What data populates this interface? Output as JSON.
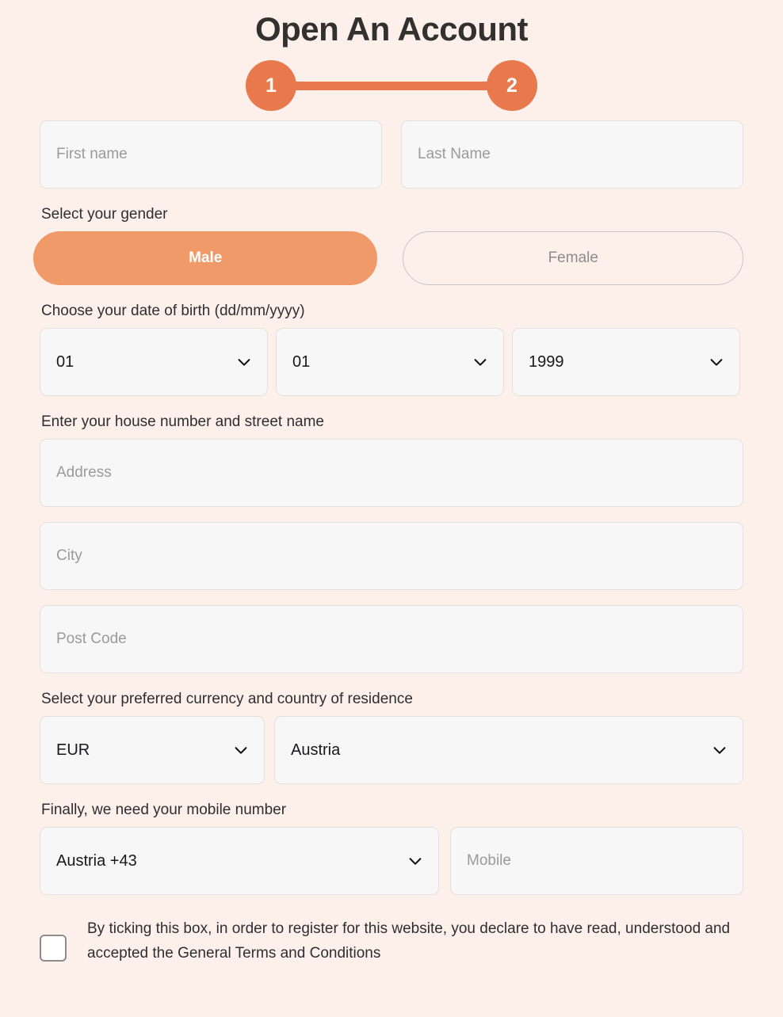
{
  "header": {
    "title": "Open An Account"
  },
  "stepper": {
    "steps": [
      {
        "number": "1",
        "state": "active"
      },
      {
        "number": "2",
        "state": "active"
      }
    ],
    "accent_color": "#e8794c"
  },
  "form": {
    "first_name": {
      "placeholder": "First name",
      "value": ""
    },
    "last_name": {
      "placeholder": "Last Name",
      "value": ""
    },
    "gender": {
      "label": "Select your gender",
      "options": [
        {
          "label": "Male",
          "selected": true
        },
        {
          "label": "Female",
          "selected": false
        }
      ],
      "selected_color": "#f09a69"
    },
    "date_of_birth": {
      "label": "Choose your date of birth (dd/mm/yyyy)",
      "day": "01",
      "month": "01",
      "year": "1999"
    },
    "address_section": {
      "label": "Enter your house number and street name",
      "address": {
        "placeholder": "Address",
        "value": ""
      },
      "city": {
        "placeholder": "City",
        "value": ""
      },
      "post_code": {
        "placeholder": "Post Code",
        "value": ""
      }
    },
    "currency_country": {
      "label": "Select your preferred currency and country of residence",
      "currency": "EUR",
      "country": "Austria"
    },
    "mobile": {
      "label": "Finally, we need your mobile number",
      "country_code": "Austria +43",
      "number": {
        "placeholder": "Mobile",
        "value": ""
      }
    },
    "terms": {
      "text": "By ticking this box, in order to register for this website, you declare to have read, understood and accepted the General Terms and Conditions",
      "checked": false
    }
  },
  "theme": {
    "background": "#fdf0ea",
    "field_background": "#f7f7f7",
    "text": "#2e2e32"
  }
}
